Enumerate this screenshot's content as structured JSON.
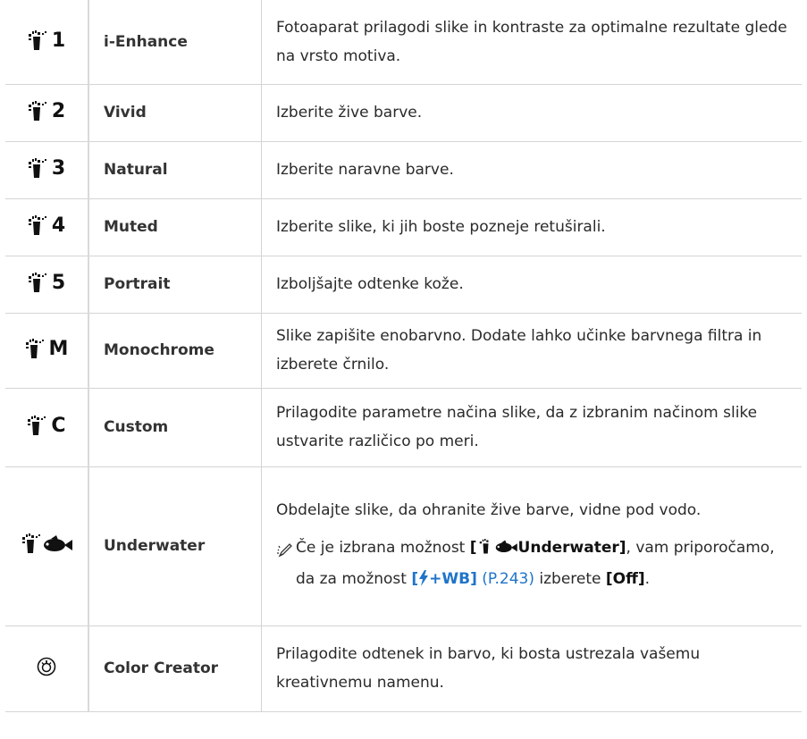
{
  "rows": [
    {
      "suffix": "1",
      "name": "i-Enhance",
      "desc": "Fotoaparat prilagodi slike in kontraste za optimalne rezultate glede na vrsto motiva."
    },
    {
      "suffix": "2",
      "name": "Vivid",
      "desc": "Izberite žive barve."
    },
    {
      "suffix": "3",
      "name": "Natural",
      "desc": "Izberite naravne barve."
    },
    {
      "suffix": "4",
      "name": "Muted",
      "desc": "Izberite slike, ki jih boste pozneje retuširali."
    },
    {
      "suffix": "5",
      "name": "Portrait",
      "desc": "Izboljšajte odtenke kože."
    },
    {
      "suffix": "M",
      "name": "Monochrome",
      "desc": "Slike zapišite enobarvno. Dodate lahko učinke barvnega filtra in izberete črnilo."
    },
    {
      "suffix": "C",
      "name": "Custom",
      "desc": "Prilagodite parametre načina slike, da z izbranim načinom slike ustvarite različico po meri."
    }
  ],
  "underwater": {
    "name": "Underwater",
    "desc": "Obdelajte slike, da ohranite žive barve, vidne pod vodo.",
    "note_prefix": "Če je izbrana možnost ",
    "note_bracket_open": "[",
    "note_option": "Underwater]",
    "note_mid": ", vam priporočamo, da za možnost ",
    "flash_open": "[",
    "flash_label": "+WB]",
    "page_ref": "(P.243)",
    "note_mid2": " izberete ",
    "off_label": "[Off]",
    "note_end": "."
  },
  "color_creator": {
    "name": "Color Creator",
    "desc": "Prilagodite odtenek in barvo, ki bosta ustrezala vašemu kreativnemu namenu."
  },
  "icons": {
    "picture_mode": "picture-mode-icon",
    "underwater": "underwater-fish-icon",
    "color_creator": "color-creator-dial-icon",
    "hint": "hint-pencil-icon",
    "flash": "flash-icon"
  },
  "colors": {
    "link": "#1f74c9",
    "rule": "#d4d4d4"
  }
}
